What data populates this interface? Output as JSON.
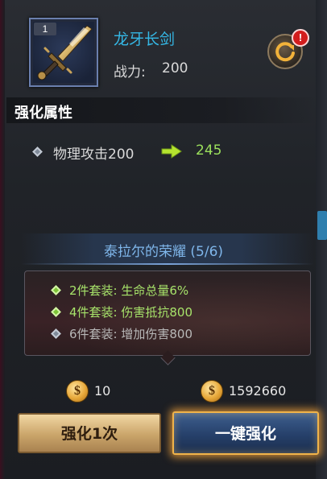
{
  "item": {
    "level_badge": "1",
    "name": "龙牙长剑",
    "power_label": "战力:",
    "power_value": "200"
  },
  "enhance_section": {
    "title": "强化属性",
    "attribute": {
      "label": "物理攻击200",
      "new_value": "245"
    }
  },
  "set_bonus": {
    "title": "泰拉尔的荣耀 (5/6)",
    "lines": [
      {
        "text": "2件套装: 生命总量6%",
        "active": true
      },
      {
        "text": "4件套装: 伤害抵抗800",
        "active": true
      },
      {
        "text": "6件套装: 增加伤害800",
        "active": false
      }
    ]
  },
  "costs": {
    "single_cost": "10",
    "balance": "1592660"
  },
  "buttons": {
    "enhance_once": "强化1次",
    "enhance_all": "一键强化"
  },
  "icons": {
    "coin": "gold-coin-icon",
    "refresh": "refresh-icon",
    "alert": "alert-icon"
  },
  "colors": {
    "item_name": "#35b8e6",
    "upgrade_value": "#9be05c",
    "set_title": "#7fb6ea",
    "set_active": "#a7e36a",
    "set_inactive": "#b8b8b8"
  }
}
